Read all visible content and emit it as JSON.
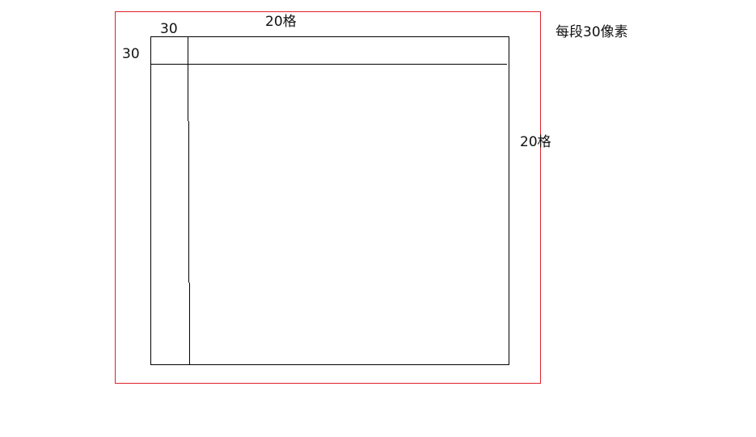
{
  "labels": {
    "cell_width": "30",
    "columns": "20格",
    "cell_height": "30",
    "rows": "20格",
    "note": "每段30像素"
  },
  "colors": {
    "outer_frame": "#e0202a",
    "grid_lines": "#000000"
  }
}
